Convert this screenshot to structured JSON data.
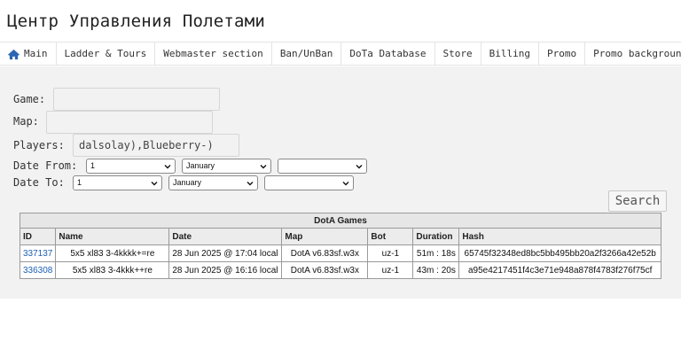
{
  "site": {
    "title": "Центр Управления Полетами"
  },
  "nav": [
    {
      "label": "Main",
      "icon": "home-icon"
    },
    {
      "label": "Ladder & Tours"
    },
    {
      "label": "Webmaster section"
    },
    {
      "label": "Ban/UnBan"
    },
    {
      "label": "DoTa Database"
    },
    {
      "label": "Store"
    },
    {
      "label": "Billing"
    },
    {
      "label": "Promo"
    },
    {
      "label": "Promo background"
    }
  ],
  "form": {
    "game_label": "Game:",
    "game_value": "",
    "map_label": "Map:",
    "map_value": "",
    "players_label": "Players:",
    "players_value": "dalsolay),Blueberry-)",
    "date_from_label": "Date From:",
    "date_from_day": "1",
    "date_from_month": "January",
    "date_from_year": "",
    "date_to_label": "Date To:",
    "date_to_day": "1",
    "date_to_month": "January",
    "date_to_year": "",
    "search_label": "Search"
  },
  "table": {
    "caption": "DotA Games",
    "headers": [
      "ID",
      "Name",
      "Date",
      "Map",
      "Bot",
      "Duration",
      "Hash"
    ],
    "rows": [
      [
        "337137",
        "5x5 xl83 3-4kkkk+=re",
        "28 Jun 2025 @ 17:04 local",
        "DotA v6.83sf.w3x",
        "uz-1",
        "51m : 18s",
        "65745f32348ed8bc5bb495bb20a2f3266a42e52b"
      ],
      [
        "336308",
        "5x5 xl83 3-4kkk++re",
        "28 Jun 2025 @ 16:16 local",
        "DotA v6.83sf.w3x",
        "uz-1",
        "43m : 20s",
        "a95e4217451f4c3e71e948a878f4783f276f75cf"
      ]
    ]
  },
  "colors": {
    "link": "#1a5fb4",
    "content_bg": "#f2f2f2",
    "nav_icon": "#2a66b3"
  }
}
